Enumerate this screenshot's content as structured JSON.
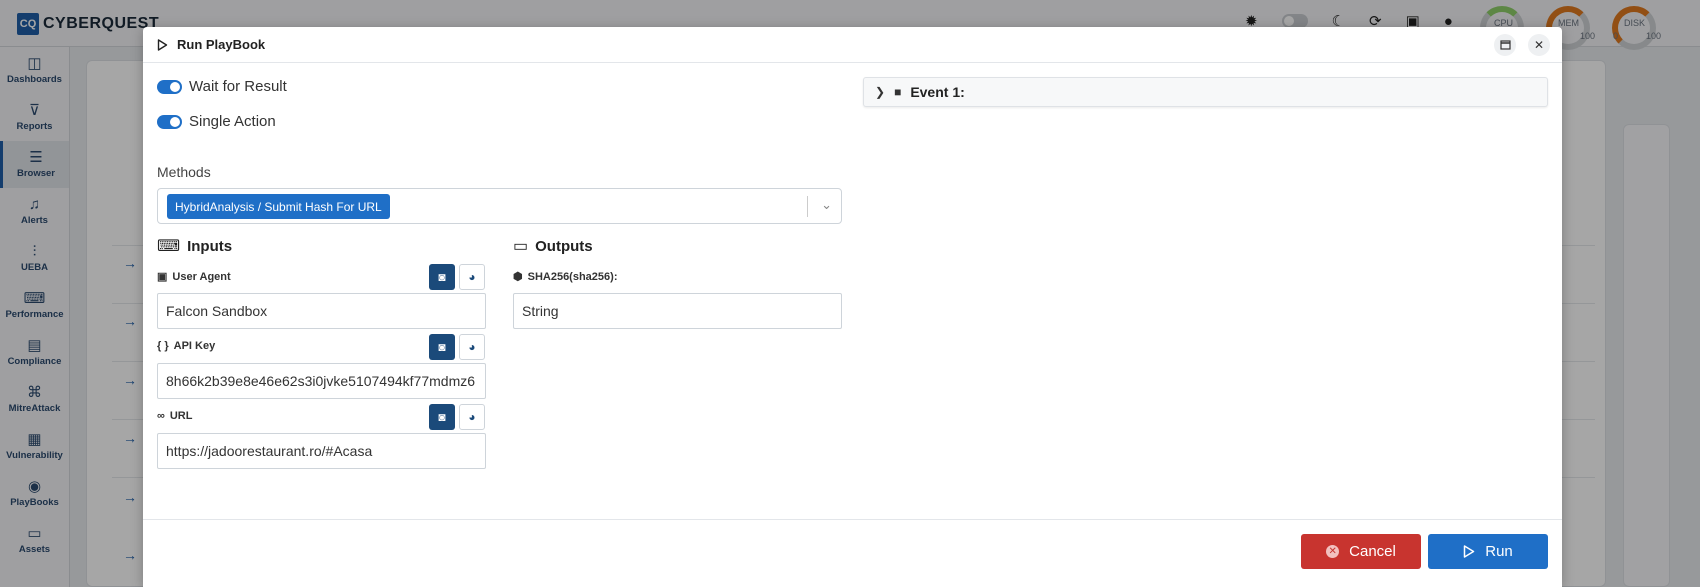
{
  "app": {
    "logo_mark": "CQ",
    "logo_text": "CYBERQUEST",
    "gauges": [
      {
        "label": "CPU",
        "min": "",
        "max": ""
      },
      {
        "label": "MEM",
        "min": "",
        "max": "100"
      },
      {
        "label": "DISK",
        "min": "0",
        "max": "100"
      }
    ]
  },
  "sidebar": {
    "items": [
      {
        "label": "Dashboards",
        "icon": "dashboard-icon",
        "glyph": "◫"
      },
      {
        "label": "Reports",
        "icon": "filter-icon",
        "glyph": "⊽"
      },
      {
        "label": "Browser",
        "icon": "list-icon",
        "glyph": "☰",
        "active": true
      },
      {
        "label": "Alerts",
        "icon": "bell-icon",
        "glyph": "🔔"
      },
      {
        "label": "UEBA",
        "icon": "chart-icon",
        "glyph": "📈"
      },
      {
        "label": "Performance",
        "icon": "keyboard-icon",
        "glyph": "⌨"
      },
      {
        "label": "Compliance",
        "icon": "document-icon",
        "glyph": "📄"
      },
      {
        "label": "MitreAttack",
        "icon": "command-icon",
        "glyph": "⌘"
      },
      {
        "label": "Vulnerability",
        "icon": "server-icon",
        "glyph": "▤"
      },
      {
        "label": "PlayBooks",
        "icon": "playbook-icon",
        "glyph": "◉"
      },
      {
        "label": "Assets",
        "icon": "laptop-icon",
        "glyph": "💻"
      }
    ]
  },
  "modal": {
    "title": "Run PlayBook",
    "toggles": [
      {
        "label": "Wait for Result",
        "on": true
      },
      {
        "label": "Single Action",
        "on": true
      }
    ],
    "methods": {
      "label": "Methods",
      "selected": "HybridAnalysis / Submit Hash For URL"
    },
    "inputs": {
      "title": "Inputs",
      "fields": [
        {
          "label": "User Agent",
          "value": "Falcon Sandbox"
        },
        {
          "label": "API Key",
          "value": "8h66k2b39e8e46e62s3i0jvke5107494kf77mdmz6"
        },
        {
          "label": "URL",
          "value": "https://jadoorestaurant.ro/#Acasa"
        }
      ]
    },
    "outputs": {
      "title": "Outputs",
      "fields": [
        {
          "label": "SHA256(sha256):",
          "value": "String"
        }
      ]
    },
    "event": {
      "label": "Event 1:"
    },
    "footer": {
      "cancel_label": "Cancel",
      "run_label": "Run"
    }
  }
}
